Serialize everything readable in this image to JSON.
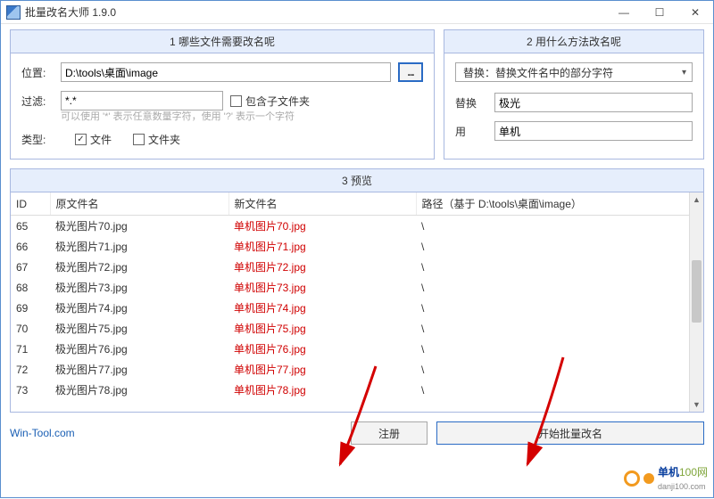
{
  "window": {
    "title": "批量改名大师 1.9.0",
    "min": "—",
    "max": "☐",
    "close": "✕"
  },
  "panel1": {
    "title": "1 哪些文件需要改名呢",
    "loc_label": "位置:",
    "loc_value": "D:\\tools\\桌面\\image",
    "browse": "...",
    "filter_label": "过滤:",
    "filter_value": "*.*",
    "include_sub": "包含子文件夹",
    "hint": "可以使用 '*' 表示任意数量字符，使用 '?' 表示一个字符",
    "type_label": "类型:",
    "type_file": "文件",
    "type_folder": "文件夹"
  },
  "panel2": {
    "title": "2 用什么方法改名呢",
    "method": "替换：替换文件名中的部分字符",
    "replace_label": "替换",
    "replace_value": "极光",
    "with_label": "用",
    "with_value": "单机"
  },
  "preview": {
    "title": "3 预览",
    "cols": {
      "id": "ID",
      "old": "原文件名",
      "new": "新文件名",
      "path": "路径（基于 D:\\tools\\桌面\\image）"
    },
    "rows": [
      {
        "id": "65",
        "old": "极光图片70.jpg",
        "new": "单机图片70.jpg",
        "path": "\\"
      },
      {
        "id": "66",
        "old": "极光图片71.jpg",
        "new": "单机图片71.jpg",
        "path": "\\"
      },
      {
        "id": "67",
        "old": "极光图片72.jpg",
        "new": "单机图片72.jpg",
        "path": "\\"
      },
      {
        "id": "68",
        "old": "极光图片73.jpg",
        "new": "单机图片73.jpg",
        "path": "\\"
      },
      {
        "id": "69",
        "old": "极光图片74.jpg",
        "new": "单机图片74.jpg",
        "path": "\\"
      },
      {
        "id": "70",
        "old": "极光图片75.jpg",
        "new": "单机图片75.jpg",
        "path": "\\"
      },
      {
        "id": "71",
        "old": "极光图片76.jpg",
        "new": "单机图片76.jpg",
        "path": "\\"
      },
      {
        "id": "72",
        "old": "极光图片77.jpg",
        "new": "单机图片77.jpg",
        "path": "\\"
      },
      {
        "id": "73",
        "old": "极光图片78.jpg",
        "new": "单机图片78.jpg",
        "path": "\\"
      }
    ]
  },
  "footer": {
    "link": "Win-Tool.com",
    "register": "注册",
    "start": "开始批量改名"
  },
  "watermark": {
    "brand1": "单机",
    "brand2": "100网",
    "url": "danji100.com"
  }
}
